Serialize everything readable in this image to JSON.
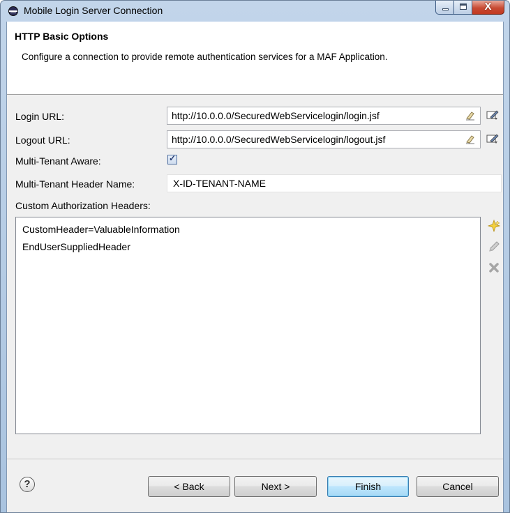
{
  "window": {
    "title": "Mobile Login Server Connection",
    "close_glyph": "X",
    "controls": [
      "minimize-icon",
      "maximize-icon",
      "close-icon"
    ]
  },
  "header": {
    "title": "HTTP Basic Options",
    "description": "Configure a connection to provide remote authentication services for a MAF Application."
  },
  "form": {
    "login_url_label": "Login URL:",
    "login_url_value": "http://10.0.0.0/SecuredWebServicelogin/login.jsf",
    "logout_url_label": "Logout URL:",
    "logout_url_value": "http://10.0.0.0/SecuredWebServicelogin/logout.jsf",
    "multi_tenant_label": "Multi-Tenant Aware:",
    "multi_tenant_checked": true,
    "multi_tenant_header_label": "Multi-Tenant Header Name:",
    "multi_tenant_header_value": "X-ID-TENANT-NAME",
    "custom_headers_label": "Custom Authorization Headers:",
    "custom_headers": [
      "CustomHeader=ValuableInformation",
      "EndUserSuppliedHeader"
    ]
  },
  "icons": {
    "field_clear": "eraser-icon",
    "field_edit": "edit-pencil-icon",
    "add": "add-icon",
    "edit": "pencil-icon",
    "delete": "delete-x-icon",
    "help": "help-icon"
  },
  "footer": {
    "help_glyph": "?",
    "back_label": "< Back",
    "next_label": "Next >",
    "finish_label": "Finish",
    "cancel_label": "Cancel"
  },
  "colors": {
    "titlebar": "#b9cee6",
    "default_button": "#bee6fd",
    "close_button": "#c84b34"
  }
}
